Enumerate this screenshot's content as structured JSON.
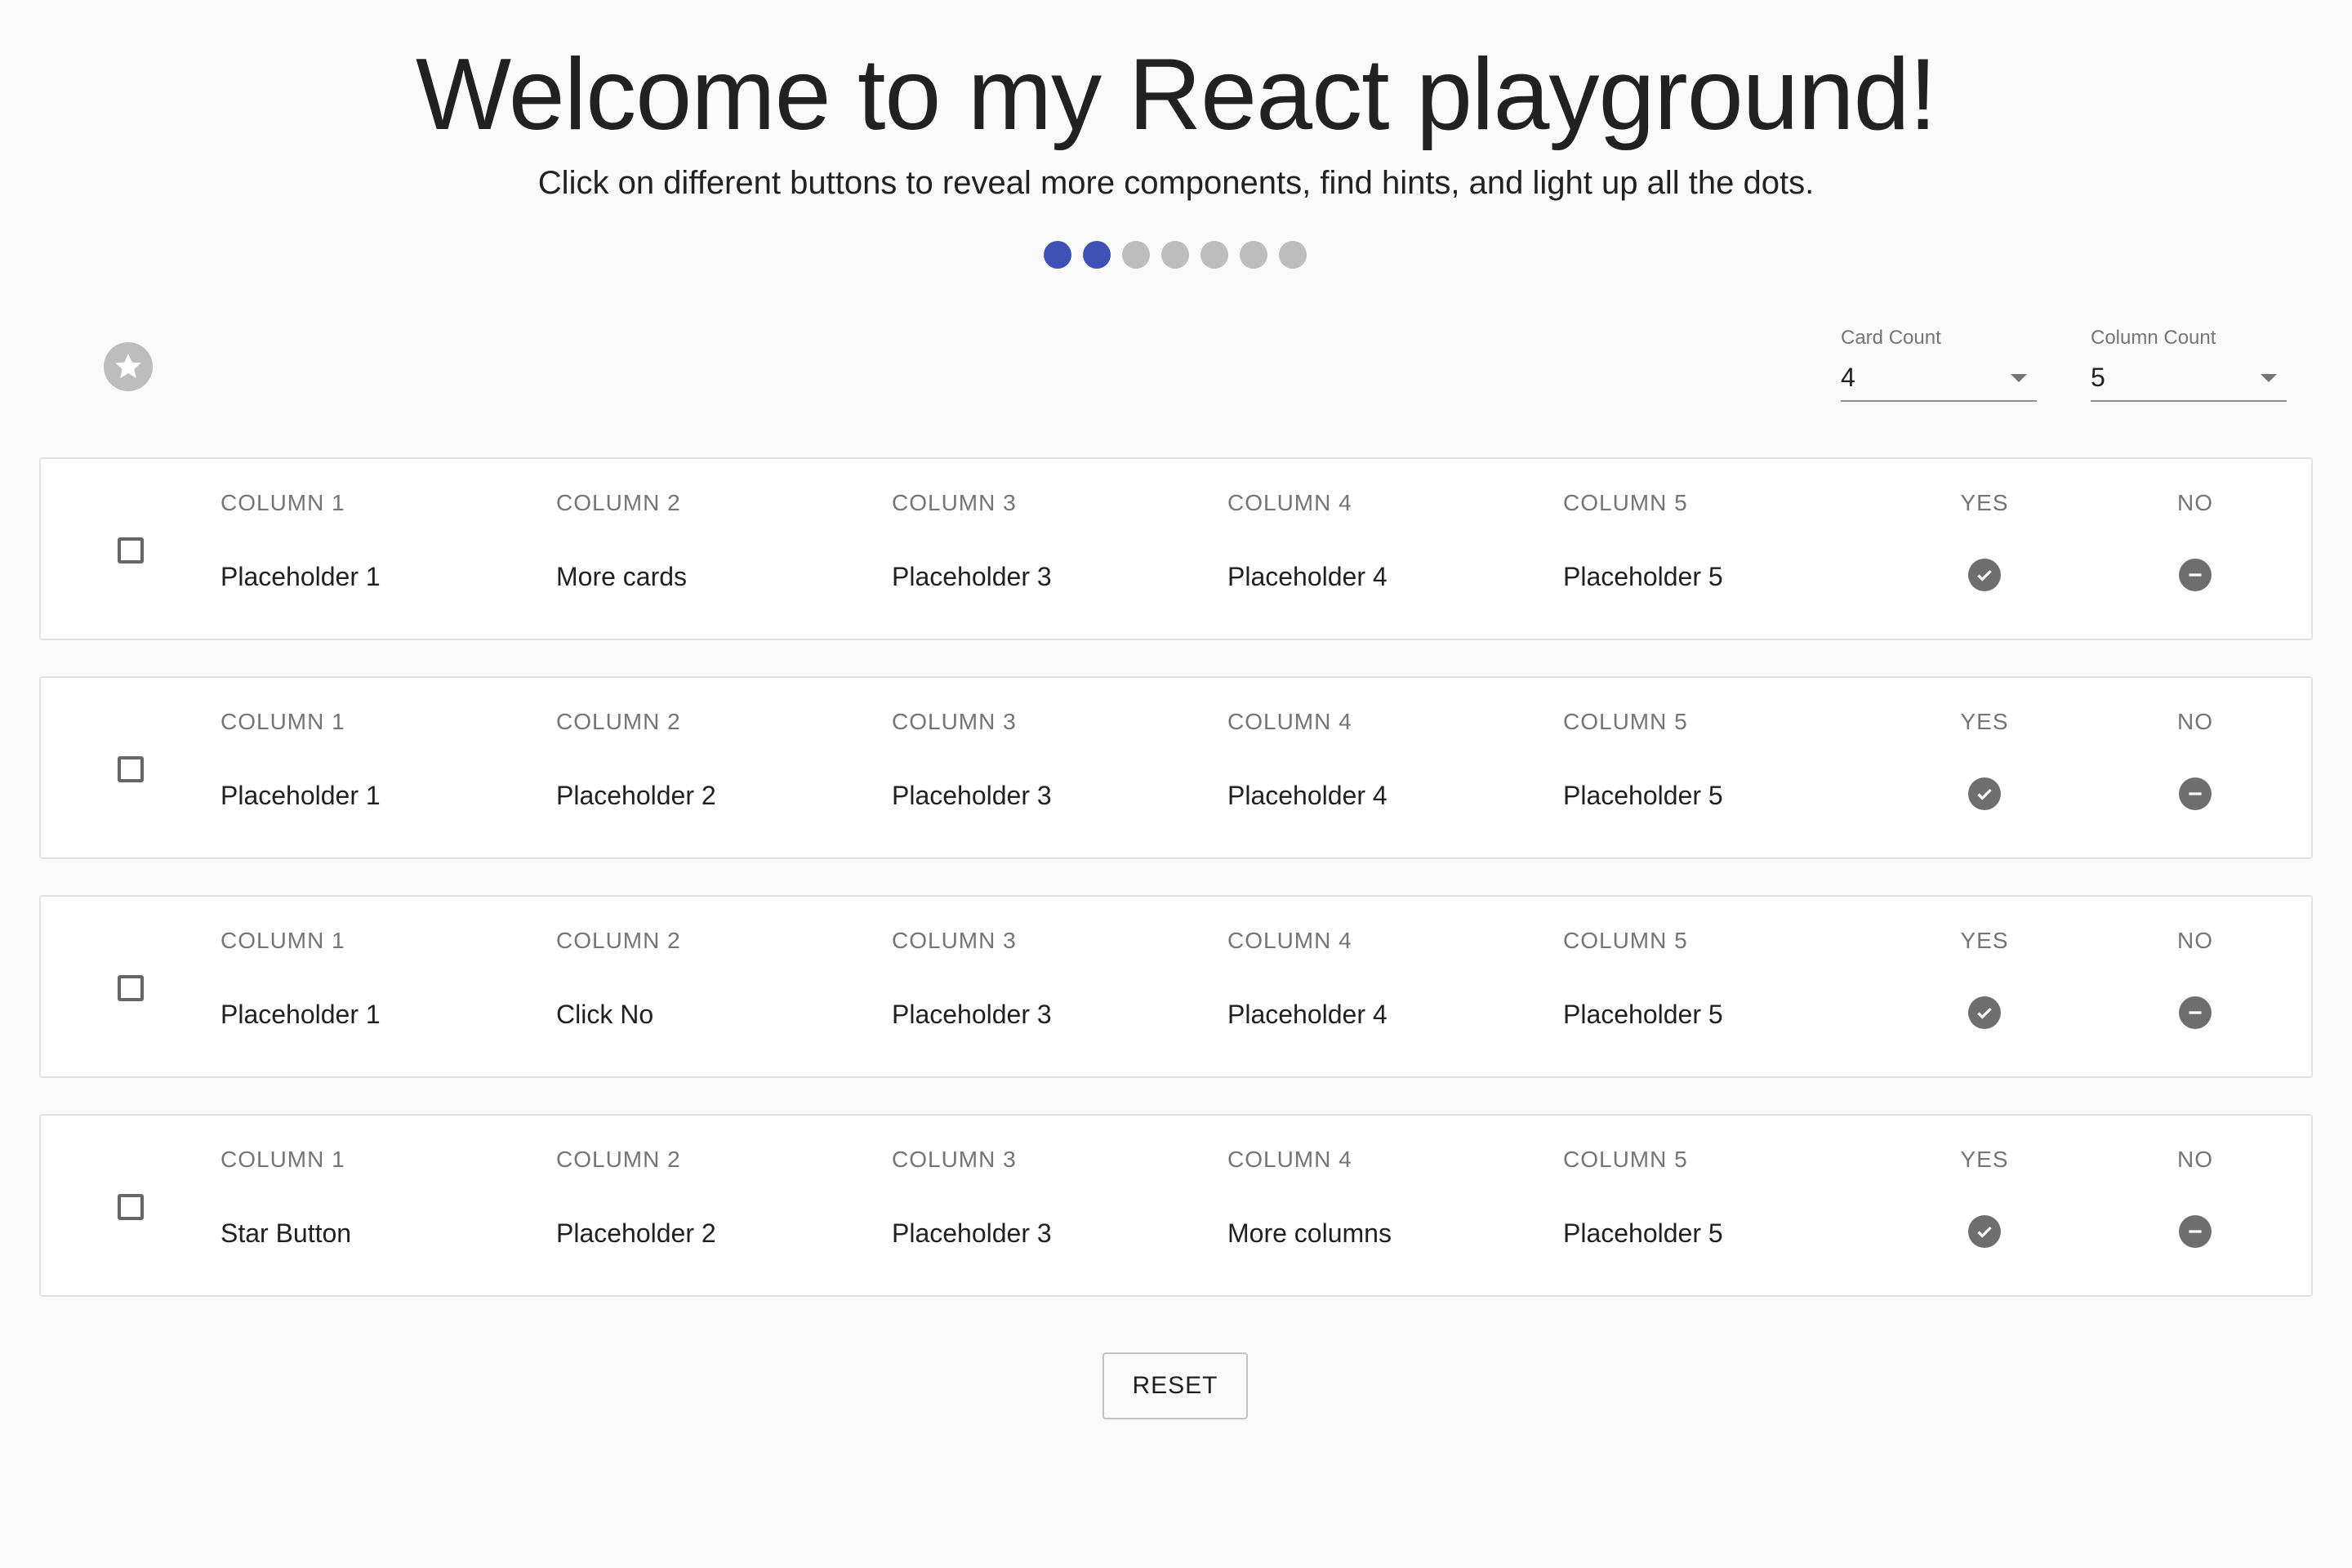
{
  "header": {
    "title": "Welcome to my React playground!",
    "subtitle": "Click on different buttons to reveal more components, find hints, and light up all the dots."
  },
  "progress": {
    "total_dots": 7,
    "lit_dots": 2,
    "lit_color": "#3f51b5",
    "unlit_color": "#bdbdbd"
  },
  "star_button": {
    "icon": "star-icon"
  },
  "selects": {
    "card_count": {
      "label": "Card Count",
      "value": "4"
    },
    "column_count": {
      "label": "Column Count",
      "value": "5"
    }
  },
  "cards": [
    {
      "headers": [
        "COLUMN 1",
        "COLUMN 2",
        "COLUMN 3",
        "COLUMN 4",
        "COLUMN 5"
      ],
      "values": [
        "Placeholder 1",
        "More cards",
        "Placeholder 3",
        "Placeholder 4",
        "Placeholder 5"
      ],
      "yes_label": "YES",
      "no_label": "NO"
    },
    {
      "headers": [
        "COLUMN 1",
        "COLUMN 2",
        "COLUMN 3",
        "COLUMN 4",
        "COLUMN 5"
      ],
      "values": [
        "Placeholder 1",
        "Placeholder 2",
        "Placeholder 3",
        "Placeholder 4",
        "Placeholder 5"
      ],
      "yes_label": "YES",
      "no_label": "NO"
    },
    {
      "headers": [
        "COLUMN 1",
        "COLUMN 2",
        "COLUMN 3",
        "COLUMN 4",
        "COLUMN 5"
      ],
      "values": [
        "Placeholder 1",
        "Click No",
        "Placeholder 3",
        "Placeholder 4",
        "Placeholder 5"
      ],
      "yes_label": "YES",
      "no_label": "NO"
    },
    {
      "headers": [
        "COLUMN 1",
        "COLUMN 2",
        "COLUMN 3",
        "COLUMN 4",
        "COLUMN 5"
      ],
      "values": [
        "Star Button",
        "Placeholder 2",
        "Placeholder 3",
        "More columns",
        "Placeholder 5"
      ],
      "yes_label": "YES",
      "no_label": "NO"
    }
  ],
  "reset_label": "RESET"
}
